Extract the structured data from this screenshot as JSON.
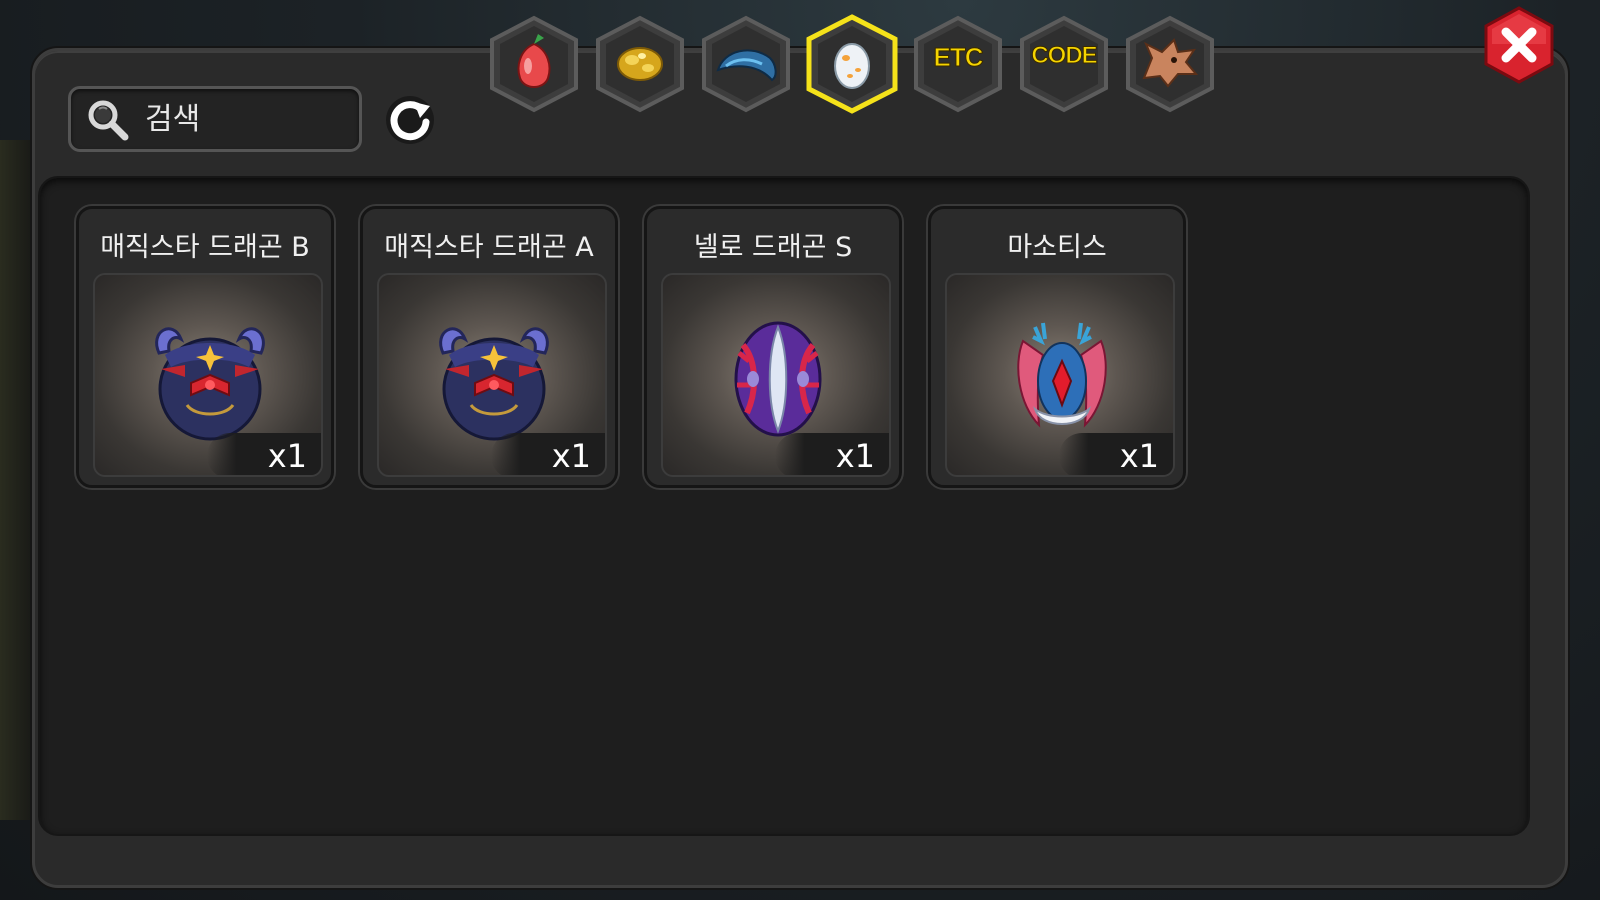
{
  "search": {
    "placeholder": "검색",
    "value": ""
  },
  "tabs": [
    {
      "name": "fruit-tab",
      "icon": "fruit-icon",
      "label": "",
      "active": false
    },
    {
      "name": "gold-tab",
      "icon": "gold-ore-icon",
      "label": "",
      "active": false
    },
    {
      "name": "scale-tab",
      "icon": "dragon-scale-icon",
      "label": "",
      "active": false
    },
    {
      "name": "egg-tab",
      "icon": "egg-icon",
      "label": "",
      "active": true
    },
    {
      "name": "etc-tab",
      "icon": "etc-icon",
      "label": "ETC",
      "active": false
    },
    {
      "name": "code-tab",
      "icon": "code-icon",
      "label": "CODE",
      "active": false
    },
    {
      "name": "dragon-tab",
      "icon": "dragon-head-icon",
      "label": "",
      "active": false
    }
  ],
  "items": [
    {
      "title": "매직스타 드래곤 B",
      "count": "x1",
      "icon": "magicstar-dragon-egg-icon"
    },
    {
      "title": "매직스타 드래곤 A",
      "count": "x1",
      "icon": "magicstar-dragon-egg-icon"
    },
    {
      "title": "넬로 드래곤 S",
      "count": "x1",
      "icon": "nello-dragon-egg-icon"
    },
    {
      "title": "마소티스",
      "count": "x1",
      "icon": "masotis-egg-icon"
    }
  ],
  "colors": {
    "active_tab_border": "#f5e21a",
    "tab_text": "#f5d400",
    "close_button": "#d9232e"
  }
}
